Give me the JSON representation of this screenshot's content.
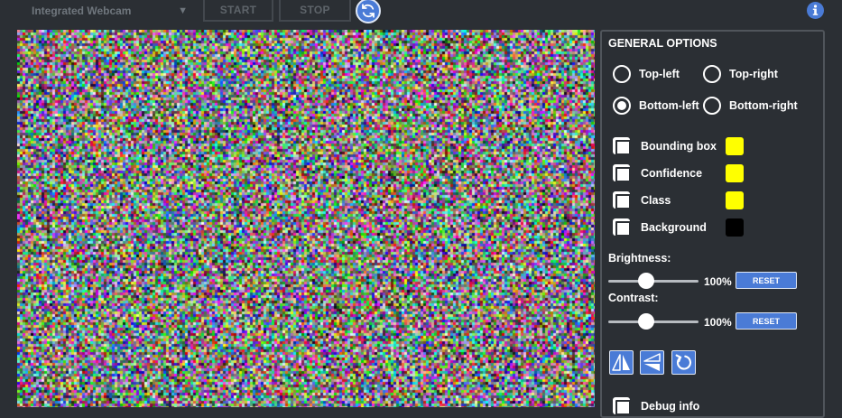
{
  "toolbar": {
    "camera_select": "Integrated Webcam",
    "start_label": "START",
    "stop_label": "STOP"
  },
  "panel": {
    "title": "GENERAL OPTIONS",
    "positions": [
      {
        "label": "Top-left",
        "selected": false
      },
      {
        "label": "Top-right",
        "selected": false
      },
      {
        "label": "Bottom-left",
        "selected": true
      },
      {
        "label": "Bottom-right",
        "selected": false
      }
    ],
    "overlays": [
      {
        "label": "Bounding box",
        "color": "#ffff00"
      },
      {
        "label": "Confidence",
        "color": "#ffff00"
      },
      {
        "label": "Class",
        "color": "#ffff00"
      },
      {
        "label": "Background",
        "color": "#000000"
      }
    ],
    "brightness": {
      "label": "Brightness:",
      "value": 1.0,
      "value_text": "100%",
      "reset_label": "RESET"
    },
    "contrast": {
      "label": "Contrast:",
      "value": 1.0,
      "value_text": "100%",
      "reset_label": "RESET"
    },
    "debug_label": "Debug info"
  },
  "colors": {
    "accent": "#4a7bd6",
    "background": "#2b2f34"
  },
  "icons": {
    "refresh": "refresh-icon",
    "info": "info-icon",
    "flip_horizontal": "flip-horizontal-icon",
    "flip_vertical": "flip-vertical-icon",
    "rotate": "rotate-icon"
  }
}
